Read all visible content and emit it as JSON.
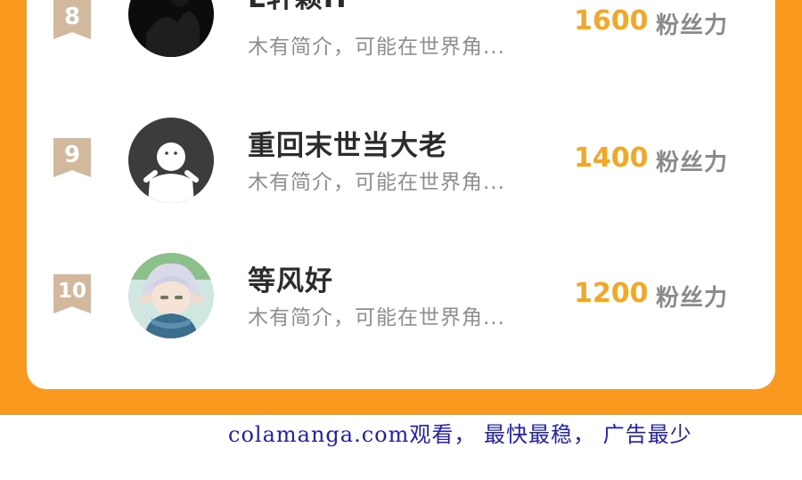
{
  "ranking": {
    "items": [
      {
        "rank": "8",
        "name": "L轩颖H",
        "desc": "木有简介，可能在世界角...",
        "fans_value": "1600",
        "fans_unit": "粉丝力",
        "avatar": "dark-avatar"
      },
      {
        "rank": "9",
        "name": "重回末世当大老",
        "desc": "木有简介，可能在世界角...",
        "fans_value": "1400",
        "fans_unit": "粉丝力",
        "avatar": "default-ghost-avatar"
      },
      {
        "rank": "10",
        "name": "等风好",
        "desc": "木有简介，可能在世界角...",
        "fans_value": "1200",
        "fans_unit": "粉丝力",
        "avatar": "anime-elf-avatar"
      }
    ]
  },
  "watermark": {
    "text": "colamanga.com观看， 最快最稳， 广告最少"
  },
  "colors": {
    "frame": "#f99a1e",
    "rank_badge": "#d2b89c",
    "fans_value": "#f5a623",
    "watermark": "#1f1fbf"
  }
}
